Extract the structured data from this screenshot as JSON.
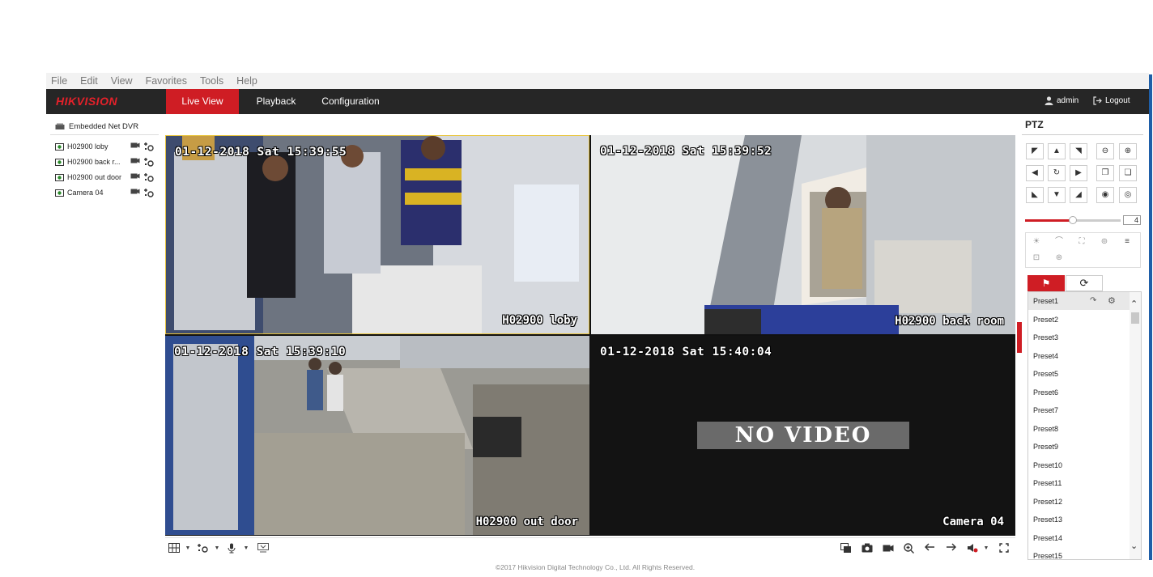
{
  "menubar": [
    "File",
    "Edit",
    "View",
    "Favorites",
    "Tools",
    "Help"
  ],
  "header": {
    "logo": "HIKVISION",
    "tabs": {
      "live": "Live View",
      "playback": "Playback",
      "config": "Configuration"
    },
    "user": "admin",
    "logout": "Logout"
  },
  "left": {
    "device": "Embedded Net DVR",
    "cameras": [
      {
        "name": "H02900 loby"
      },
      {
        "name": "H02900 back r..."
      },
      {
        "name": "H02900 out door"
      },
      {
        "name": "Camera 04"
      }
    ]
  },
  "tiles": [
    {
      "ts": "01-12-2018 Sat 15:39:55",
      "name": "H02900 loby"
    },
    {
      "ts": "01-12-2018 Sat 15:39:52",
      "name": "H02900 back room"
    },
    {
      "ts": "01-12-2018 Sat 15:39:10",
      "name": "H02900 out door"
    },
    {
      "ts": "01-12-2018 Sat 15:40:04",
      "name": "Camera 04",
      "no_video": "NO VIDEO"
    }
  ],
  "ptz": {
    "title": "PTZ",
    "speed": "4",
    "speed_level": 0.5,
    "presets": [
      "Preset1",
      "Preset2",
      "Preset3",
      "Preset4",
      "Preset5",
      "Preset6",
      "Preset7",
      "Preset8",
      "Preset9",
      "Preset10",
      "Preset11",
      "Preset12",
      "Preset13",
      "Preset14",
      "Preset15"
    ]
  },
  "footer": "©2017 Hikvision Digital Technology Co., Ltd. All Rights Reserved.",
  "colors": {
    "accent": "#cf1d24",
    "header_bg": "#262626",
    "selected_border": "#e9c43b"
  }
}
